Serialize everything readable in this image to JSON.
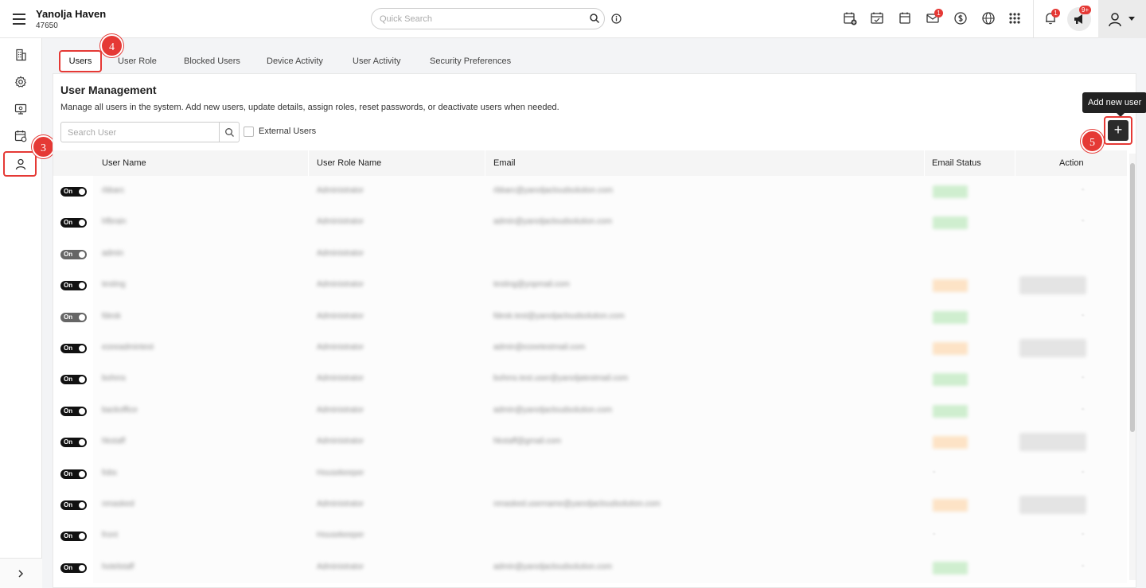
{
  "header": {
    "hotel_name": "Yanolja Haven",
    "hotel_id": "47650",
    "search_placeholder": "Quick Search",
    "mail_badge": "1",
    "notification_badge": "1",
    "announcement_badge": "9+"
  },
  "steps": {
    "three": "3",
    "four": "4",
    "five": "5"
  },
  "tabs": [
    {
      "label": "Users"
    },
    {
      "label": "User Role"
    },
    {
      "label": "Blocked Users"
    },
    {
      "label": "Device Activity"
    },
    {
      "label": "User Activity"
    },
    {
      "label": "Security Preferences"
    }
  ],
  "page": {
    "title": "User Management",
    "description": "Manage all users in the system. Add new users, update details, assign roles, reset passwords, or deactivate users when needed.",
    "search_placeholder": "Search User",
    "external_users_label": "External Users",
    "add_tooltip": "Add new user",
    "add_button": "+"
  },
  "table": {
    "columns": [
      "User Name",
      "User Role Name",
      "Email",
      "Email Status",
      "Action"
    ],
    "rows": [
      {
        "toggle": "On",
        "toggle_dim": false,
        "name": "rbbarc",
        "role": "Administrator",
        "email": "rbbarc@yanoljacloudsolution.com",
        "status": "ok",
        "action": "dash"
      },
      {
        "toggle": "On",
        "toggle_dim": false,
        "name": "hfbrain",
        "role": "Administrator",
        "email": "admin@yanoljacloudsolution.com",
        "status": "ok",
        "action": "dash"
      },
      {
        "toggle": "On",
        "toggle_dim": true,
        "name": "admin",
        "role": "Administrator",
        "email": "",
        "status": "",
        "action": ""
      },
      {
        "toggle": "On",
        "toggle_dim": false,
        "name": "testing",
        "role": "Administrator",
        "email": "testing@yopmail.com",
        "status": "pending",
        "action": "button"
      },
      {
        "toggle": "On",
        "toggle_dim": true,
        "name": "fdesk",
        "role": "Administrator",
        "email": "fdesk.test@yanoljacloudsolution.com",
        "status": "ok",
        "action": "dash"
      },
      {
        "toggle": "On",
        "toggle_dim": false,
        "name": "ezeeadmintest",
        "role": "Administrator",
        "email": "admin@ezeetestmail.com",
        "status": "pending",
        "action": "button"
      },
      {
        "toggle": "On",
        "toggle_dim": false,
        "name": "bohms",
        "role": "Administrator",
        "email": "bohms.test.user@yanoljatestmail.com",
        "status": "ok",
        "action": "dash"
      },
      {
        "toggle": "On",
        "toggle_dim": false,
        "name": "backoffice",
        "role": "Administrator",
        "email": "admin@yanoljacloudsolution.com",
        "status": "ok",
        "action": "dash"
      },
      {
        "toggle": "On",
        "toggle_dim": false,
        "name": "hkstaff",
        "role": "Administrator",
        "email": "hkstaff@gmail.com",
        "status": "pending",
        "action": "button"
      },
      {
        "toggle": "On",
        "toggle_dim": false,
        "name": "fobs",
        "role": "Housekeeper",
        "email": "",
        "status": "dash",
        "action": "dash"
      },
      {
        "toggle": "On",
        "toggle_dim": false,
        "name": "nmasked",
        "role": "Administrator",
        "email": "nmasked.username@yanoljacloudsolution.com",
        "status": "pending",
        "action": "button"
      },
      {
        "toggle": "On",
        "toggle_dim": false,
        "name": "front",
        "role": "Housekeeper",
        "email": "",
        "status": "dash",
        "action": "dash"
      },
      {
        "toggle": "On",
        "toggle_dim": false,
        "name": "hotelstaff",
        "role": "Administrator",
        "email": "admin@yanoljacloudsolution.com",
        "status": "ok",
        "action": "dash"
      }
    ]
  }
}
